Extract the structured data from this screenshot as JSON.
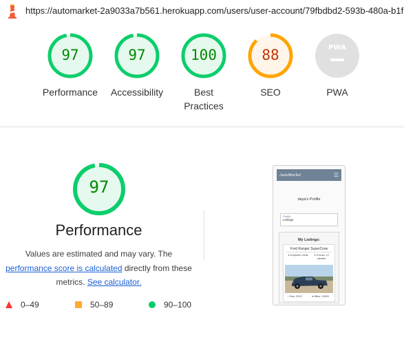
{
  "browser": {
    "url": "https://automarket-2a9033a7b561.herokuapp.com/users/user-account/79fbdbd2-593b-480a-b1fb-..."
  },
  "categories": [
    {
      "score": "97",
      "label_line1": "Performance",
      "label_line2": "",
      "value": 97,
      "status": "pass"
    },
    {
      "score": "97",
      "label_line1": "Accessibility",
      "label_line2": "",
      "value": 97,
      "status": "pass"
    },
    {
      "score": "100",
      "label_line1": "Best",
      "label_line2": "Practices",
      "value": 100,
      "status": "pass"
    },
    {
      "score": "88",
      "label_line1": "SEO",
      "label_line2": "",
      "value": 88,
      "status": "average"
    },
    {
      "score": "",
      "label_line1": "PWA",
      "label_line2": "",
      "value": null,
      "status": "na"
    }
  ],
  "colors": {
    "pass": "#0cce6b",
    "pass_text": "#008800",
    "pass_fill": "#e6f9ee",
    "average": "#ffa400",
    "average_text": "#c33300",
    "average_fill": "#fff6e9",
    "fail": "#ff3333",
    "na": "#e0e0e0",
    "link": "#1a5fd6"
  },
  "pwa_badge": {
    "text": "PWA"
  },
  "performance": {
    "score": "97",
    "value": 97,
    "title": "Performance",
    "desc_line1": "Values are estimated and may vary. The",
    "desc_link1": "performance score is calculated",
    "desc_line2_rest": " directly from these",
    "desc_line3_pre": "metrics. ",
    "desc_link2": "See calculator.",
    "legend": [
      {
        "icon": "triangle-icon",
        "range": "0–49"
      },
      {
        "icon": "square-icon",
        "range": "50–89"
      },
      {
        "icon": "circle-icon",
        "range": "90–100"
      }
    ]
  },
  "screenshot": {
    "brand": "AutoMarket",
    "menu_glyph": "☰",
    "profile_title": "daya's Profile",
    "card_label": "Profile",
    "card_value": "Listings",
    "my_listings": "My Listings:",
    "car_name": "Ford Ranger SuperCrew",
    "meta_left": "Dropbdile Leeds",
    "meta_right": "8 hours, 13 minutes",
    "year": "Year: 2020",
    "miles": "Miles: 15300"
  }
}
